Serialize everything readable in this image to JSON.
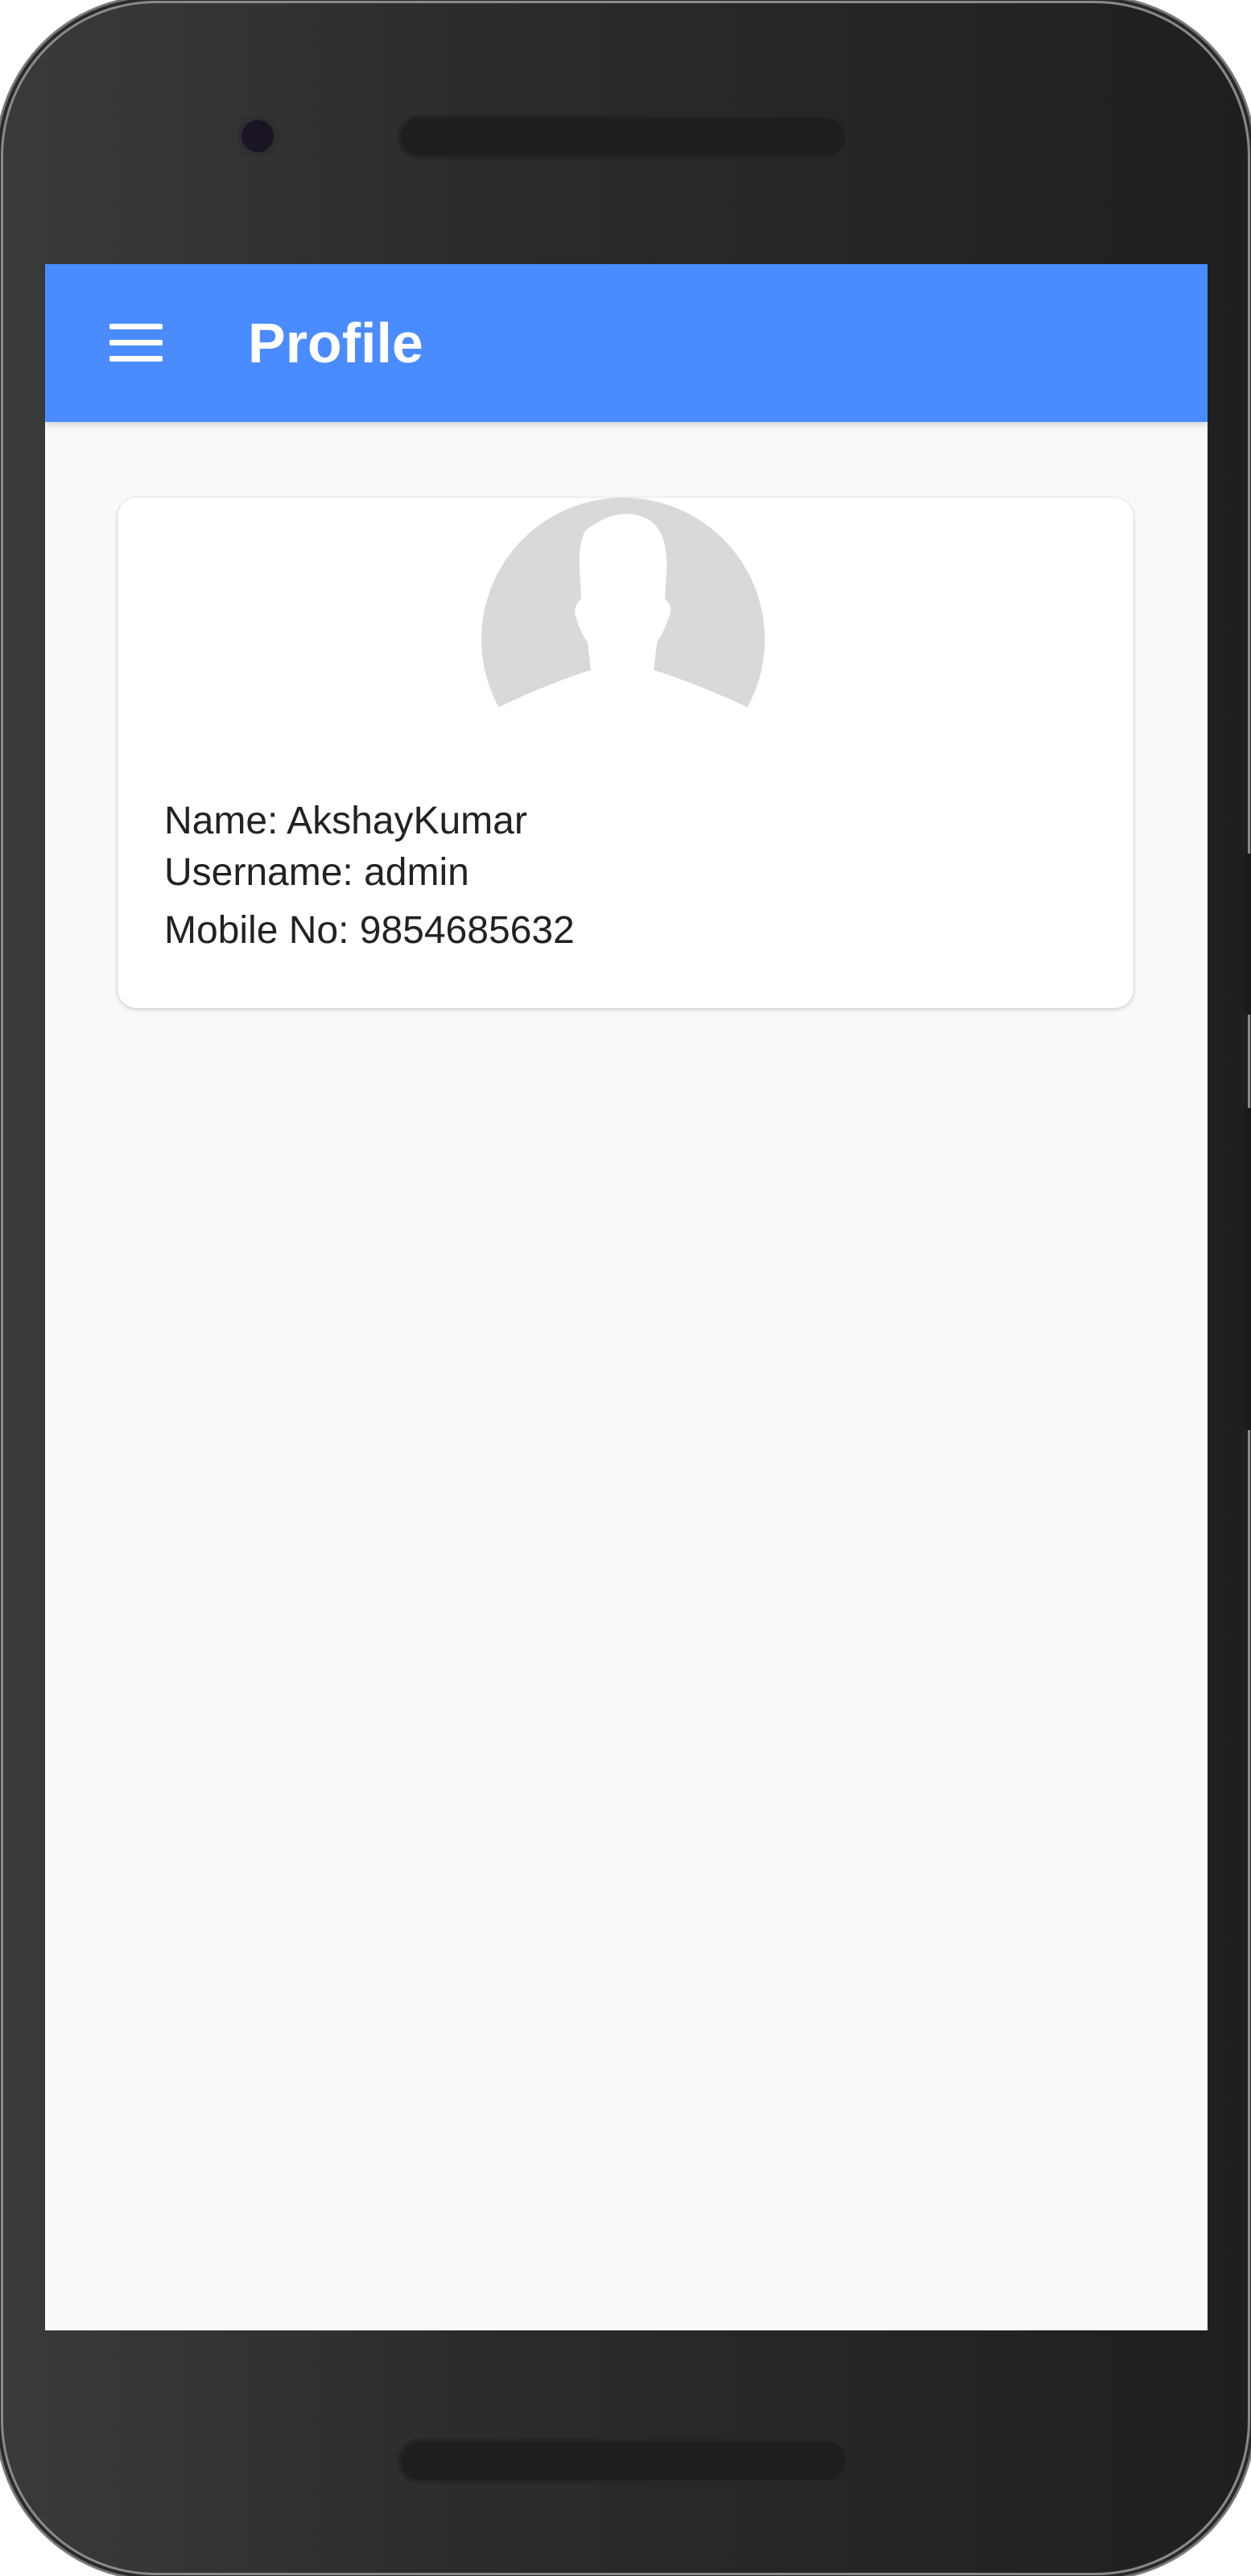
{
  "app_bar": {
    "title": "Profile",
    "menu_icon": "hamburger-menu-icon"
  },
  "profile": {
    "avatar_icon": "user-silhouette-icon",
    "name_line": "Name: AkshayKumar",
    "username_line": "Username: admin",
    "mobile_line": "Mobile No: 9854685632"
  },
  "colors": {
    "app_bar": "#4a8cff",
    "screen_bg": "#f8f9fb",
    "card_bg": "#ffffff",
    "avatar": "#d9d9d9"
  }
}
